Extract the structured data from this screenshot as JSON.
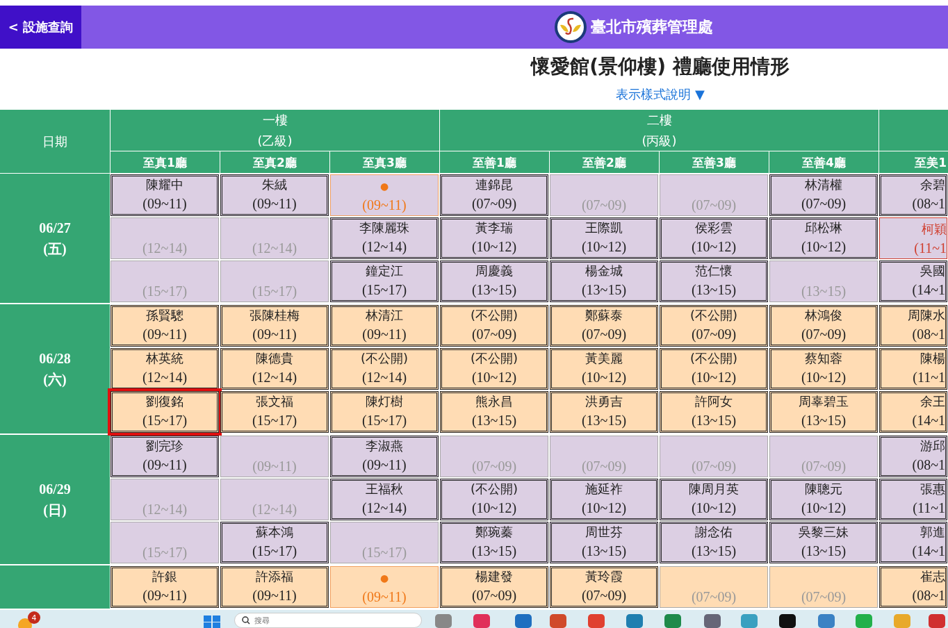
{
  "header": {
    "back_button": "< 設施查詢",
    "org_title": "臺北市殯葬管理處"
  },
  "page_title": "懷愛館(景仰樓) 禮廳使用情形",
  "legend_link": "表示樣式說明 ▼",
  "table": {
    "date_heading": "日期",
    "floors": [
      {
        "name": "一樓",
        "grade": "(乙級)",
        "halls": [
          "至真1廳",
          "至真2廳",
          "至真3廳"
        ]
      },
      {
        "name": "二樓",
        "grade": "(丙級)",
        "halls": [
          "至善1廳",
          "至善2廳",
          "至善3廳",
          "至善4廳"
        ]
      },
      {
        "halls": [
          "至美1"
        ]
      }
    ],
    "days": [
      {
        "date": "06/27",
        "weekday": "(五)",
        "color": "#dccfe3",
        "rows": [
          {
            "cells": [
              {
                "kind": "booked",
                "name": "陳耀中",
                "time": "(09~11)"
              },
              {
                "kind": "booked",
                "name": "朱絨",
                "time": "(09~11)"
              },
              {
                "kind": "pending",
                "name": "●",
                "time": "(09~11)"
              },
              {
                "kind": "booked",
                "name": "連錦昆",
                "time": "(07~09)"
              },
              {
                "kind": "open",
                "time": "(07~09)"
              },
              {
                "kind": "open",
                "time": "(07~09)"
              },
              {
                "kind": "booked",
                "name": "林清權",
                "time": "(07~09)"
              },
              {
                "kind": "booked",
                "name": "余碧",
                "time": "(08~1"
              }
            ]
          },
          {
            "cells": [
              {
                "kind": "open",
                "time": "(12~14)"
              },
              {
                "kind": "open",
                "time": "(12~14)"
              },
              {
                "kind": "booked",
                "name": "李陳麗珠",
                "time": "(12~14)"
              },
              {
                "kind": "booked",
                "name": "黃李瑞",
                "time": "(10~12)"
              },
              {
                "kind": "booked",
                "name": "王際凱",
                "time": "(10~12)"
              },
              {
                "kind": "booked",
                "name": "侯彩雲",
                "time": "(10~12)"
              },
              {
                "kind": "booked",
                "name": "邱松琳",
                "time": "(10~12)"
              },
              {
                "kind": "special",
                "name": "柯穎",
                "time": "(11~1"
              }
            ]
          },
          {
            "cells": [
              {
                "kind": "open",
                "time": "(15~17)"
              },
              {
                "kind": "open",
                "time": "(15~17)"
              },
              {
                "kind": "booked",
                "name": "鐘定江",
                "time": "(15~17)"
              },
              {
                "kind": "booked",
                "name": "周慶義",
                "time": "(13~15)"
              },
              {
                "kind": "booked",
                "name": "楊金城",
                "time": "(13~15)"
              },
              {
                "kind": "booked",
                "name": "范仁懷",
                "time": "(13~15)"
              },
              {
                "kind": "open",
                "time": "(13~15)"
              },
              {
                "kind": "booked",
                "name": "吳國",
                "time": "(14~1"
              }
            ]
          }
        ]
      },
      {
        "date": "06/28",
        "weekday": "(六)",
        "color": "#ffdcb4",
        "rows": [
          {
            "cells": [
              {
                "kind": "booked",
                "name": "孫賢驄",
                "time": "(09~11)"
              },
              {
                "kind": "booked",
                "name": "張陳桂梅",
                "time": "(09~11)"
              },
              {
                "kind": "booked",
                "name": "林清江",
                "time": "(09~11)"
              },
              {
                "kind": "booked",
                "name": "(不公開)",
                "time": "(07~09)"
              },
              {
                "kind": "booked",
                "name": "鄭蘇泰",
                "time": "(07~09)"
              },
              {
                "kind": "booked",
                "name": "(不公開)",
                "time": "(07~09)"
              },
              {
                "kind": "booked",
                "name": "林鴻俊",
                "time": "(07~09)"
              },
              {
                "kind": "booked",
                "name": "周陳水",
                "time": "(08~1"
              }
            ]
          },
          {
            "cells": [
              {
                "kind": "booked",
                "name": "林英統",
                "time": "(12~14)"
              },
              {
                "kind": "booked",
                "name": "陳德貴",
                "time": "(12~14)"
              },
              {
                "kind": "booked",
                "name": "(不公開)",
                "time": "(12~14)"
              },
              {
                "kind": "booked",
                "name": "(不公開)",
                "time": "(10~12)"
              },
              {
                "kind": "booked",
                "name": "黃美麗",
                "time": "(10~12)"
              },
              {
                "kind": "booked",
                "name": "(不公開)",
                "time": "(10~12)"
              },
              {
                "kind": "booked",
                "name": "蔡知蓉",
                "time": "(10~12)"
              },
              {
                "kind": "booked",
                "name": "陳楊",
                "time": "(11~1"
              }
            ]
          },
          {
            "cells": [
              {
                "kind": "booked",
                "name": "劉復銘",
                "time": "(15~17)",
                "highlighted": true
              },
              {
                "kind": "booked",
                "name": "張文福",
                "time": "(15~17)"
              },
              {
                "kind": "booked",
                "name": "陳灯樹",
                "time": "(15~17)"
              },
              {
                "kind": "booked",
                "name": "熊永昌",
                "time": "(13~15)"
              },
              {
                "kind": "booked",
                "name": "洪勇吉",
                "time": "(13~15)"
              },
              {
                "kind": "booked",
                "name": "許阿女",
                "time": "(13~15)"
              },
              {
                "kind": "booked",
                "name": "周辜碧玉",
                "time": "(13~15)"
              },
              {
                "kind": "booked",
                "name": "余王",
                "time": "(14~1"
              }
            ]
          }
        ]
      },
      {
        "date": "06/29",
        "weekday": "(日)",
        "color": "#dccfe3",
        "rows": [
          {
            "cells": [
              {
                "kind": "booked",
                "name": "劉完珍",
                "time": "(09~11)"
              },
              {
                "kind": "open",
                "time": "(09~11)"
              },
              {
                "kind": "booked",
                "name": "李淑燕",
                "time": "(09~11)"
              },
              {
                "kind": "open",
                "time": "(07~09)"
              },
              {
                "kind": "open",
                "time": "(07~09)"
              },
              {
                "kind": "open",
                "time": "(07~09)"
              },
              {
                "kind": "open",
                "time": "(07~09)"
              },
              {
                "kind": "booked",
                "name": "游邱",
                "time": "(08~1"
              }
            ]
          },
          {
            "cells": [
              {
                "kind": "open",
                "time": "(12~14)"
              },
              {
                "kind": "open",
                "time": "(12~14)"
              },
              {
                "kind": "booked",
                "name": "王福秋",
                "time": "(12~14)"
              },
              {
                "kind": "booked",
                "name": "(不公開)",
                "time": "(10~12)"
              },
              {
                "kind": "booked",
                "name": "施延祚",
                "time": "(10~12)"
              },
              {
                "kind": "booked",
                "name": "陳周月英",
                "time": "(10~12)"
              },
              {
                "kind": "booked",
                "name": "陳聰元",
                "time": "(10~12)"
              },
              {
                "kind": "booked",
                "name": "張惠",
                "time": "(11~1"
              }
            ]
          },
          {
            "cells": [
              {
                "kind": "open",
                "time": "(15~17)"
              },
              {
                "kind": "booked",
                "name": "蘇本鴻",
                "time": "(15~17)"
              },
              {
                "kind": "open",
                "time": "(15~17)"
              },
              {
                "kind": "booked",
                "name": "鄭琬蓁",
                "time": "(13~15)"
              },
              {
                "kind": "booked",
                "name": "周世芬",
                "time": "(13~15)"
              },
              {
                "kind": "booked",
                "name": "謝念佑",
                "time": "(13~15)"
              },
              {
                "kind": "booked",
                "name": "吳黎三妹",
                "time": "(13~15)"
              },
              {
                "kind": "booked",
                "name": "郭進",
                "time": "(14~1"
              }
            ]
          }
        ]
      },
      {
        "color": "#ffdcb4",
        "rows": [
          {
            "cells": [
              {
                "kind": "booked",
                "name": "許銀",
                "time": "(09~11)"
              },
              {
                "kind": "booked",
                "name": "許添福",
                "time": "(09~11)"
              },
              {
                "kind": "pending",
                "name": "●",
                "time": "(09~11)"
              },
              {
                "kind": "booked",
                "name": "楊建發",
                "time": "(07~09)"
              },
              {
                "kind": "booked",
                "name": "黃玲霞",
                "time": "(07~09)"
              },
              {
                "kind": "open",
                "time": "(07~09)"
              },
              {
                "kind": "open",
                "time": "(07~09)"
              },
              {
                "kind": "booked",
                "name": "崔志",
                "time": "(08~1"
              }
            ]
          }
        ]
      }
    ]
  },
  "taskbar": {
    "weather_badge": "4",
    "search": {
      "placeholder": "搜尋"
    }
  }
}
